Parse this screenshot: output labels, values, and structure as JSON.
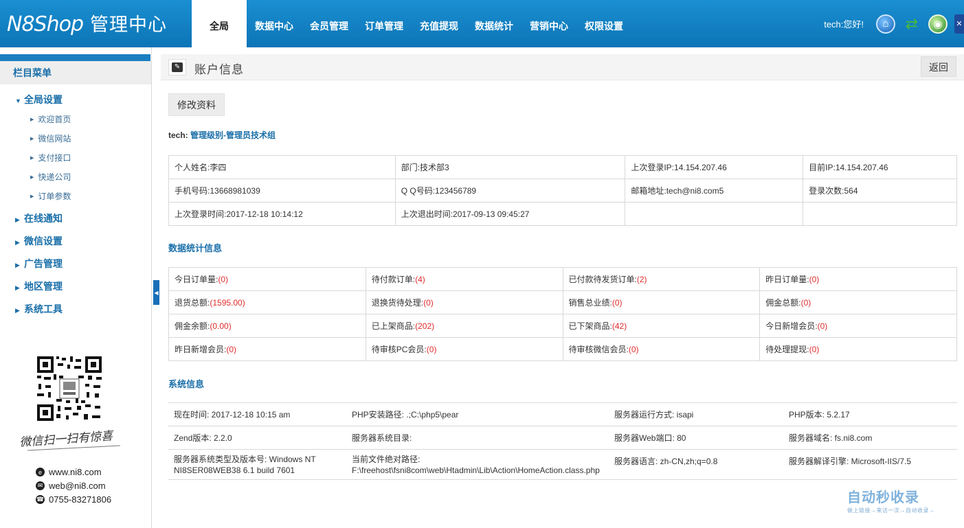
{
  "header": {
    "brand": "N8Shop",
    "subtitle": "管理中心",
    "nav": [
      "全局",
      "数据中心",
      "会员管理",
      "订单管理",
      "充值提现",
      "数据统计",
      "营销中心",
      "权限设置"
    ],
    "greeting": "tech:您好!",
    "icons": [
      "home-icon",
      "swap-icon",
      "globe-icon",
      "exit-icon"
    ]
  },
  "sidebar": {
    "title": "栏目菜单",
    "groups": [
      {
        "label": "全局设置",
        "expanded": true,
        "items": [
          "欢迎首页",
          "微信网站",
          "支付接口",
          "快递公司",
          "订单参数"
        ]
      },
      {
        "label": "在线通知"
      },
      {
        "label": "微信设置"
      },
      {
        "label": "广告管理"
      },
      {
        "label": "地区管理"
      },
      {
        "label": "系统工具"
      }
    ],
    "signature": "微信扫一扫有惊喜",
    "contacts": {
      "web": "www.ni8.com",
      "email": "web@ni8.com",
      "phone": "0755-83271806"
    }
  },
  "main": {
    "page_title": "账户信息",
    "back_label": "返回",
    "edit_label": "修改资料",
    "user_prefix": "tech:",
    "user_role": "管理级别-管理员技术组",
    "account": {
      "name_label": "个人姓名:",
      "name": "李四",
      "dept_label": "部门:",
      "dept": "技术部3",
      "last_ip_label": "上次登录IP:",
      "last_ip": "14.154.207.46",
      "cur_ip_label": "目前IP:",
      "cur_ip": "14.154.207.46",
      "phone_label": "手机号码:",
      "phone": "13668981039",
      "qq_label": "Q Q号码:",
      "qq": "123456789",
      "email_label": "邮箱地址:",
      "email": "tech@ni8.com5",
      "login_count_label": "登录次数:",
      "login_count": "564",
      "last_login_label": "上次登录时间:",
      "last_login": "2017-12-18 10:14:12",
      "last_logout_label": "上次退出时间:",
      "last_logout": "2017-09-13 09:45:27"
    },
    "stats_title": "数据统计信息",
    "stats": [
      [
        {
          "label": "今日订单量:",
          "value": "(0)"
        },
        {
          "label": "待付款订单:",
          "value": "(4)"
        },
        {
          "label": "已付款待发货订单:",
          "value": "(2)"
        },
        {
          "label": "昨日订单量:",
          "value": "(0)"
        }
      ],
      [
        {
          "label": "退货总额:",
          "value": "(1595.00)"
        },
        {
          "label": "退换货待处理:",
          "value": "(0)"
        },
        {
          "label": "销售总业绩:",
          "value": "(0)"
        },
        {
          "label": "佣金总额:",
          "value": "(0)"
        }
      ],
      [
        {
          "label": "佣金余额:",
          "value": "(0.00)"
        },
        {
          "label": "已上架商品:",
          "value": "(202)"
        },
        {
          "label": "已下架商品:",
          "value": "(42)"
        },
        {
          "label": "今日新增会员:",
          "value": "(0)"
        }
      ],
      [
        {
          "label": "昨日新增会员:",
          "value": "(0)"
        },
        {
          "label": "待审核PC会员:",
          "value": "(0)"
        },
        {
          "label": "待审核微信会员:",
          "value": "(0)"
        },
        {
          "label": "待处理提现:",
          "value": "(0)"
        }
      ]
    ],
    "sys_title": "系统信息",
    "sys": [
      [
        "现在时间: 2017-12-18 10:15 am",
        "PHP安装路径: .;C:\\php5\\pear",
        "服务器运行方式: isapi",
        "PHP版本: 5.2.17"
      ],
      [
        "Zend版本: 2.2.0",
        "服务器系统目录:",
        "服务器Web端口: 80",
        "服务器域名: fs.ni8.com"
      ],
      [
        "服务器系统类型及版本号: Windows NT NI8SER08WEB38 6.1 build 7601",
        "当前文件绝对路径: F:\\freehost\\fsni8com\\web\\Htadmin\\Lib\\Action\\HomeAction.class.php",
        "服务器语言: zh-CN,zh;q=0.8",
        "服务器解译引擎: Microsoft-IIS/7.5"
      ]
    ]
  },
  "watermark": {
    "main": "自动秒收录",
    "sub": "做上链接→来访一次→自动收录→"
  }
}
